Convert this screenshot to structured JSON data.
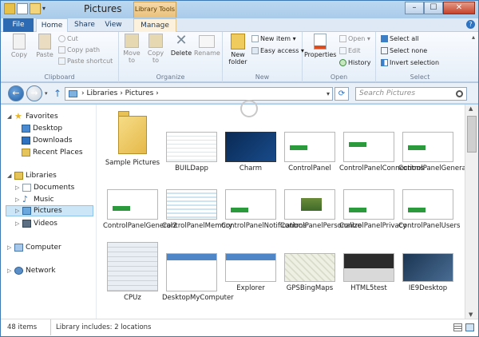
{
  "window": {
    "title": "Pictures",
    "context_tab": "Library Tools",
    "buttons": {
      "minimize": "–",
      "maximize": "☐",
      "close": "✕"
    }
  },
  "tabs": [
    "File",
    "Home",
    "Share",
    "View",
    "Manage"
  ],
  "ribbon": {
    "clipboard": {
      "label": "Clipboard",
      "copy": "Copy",
      "paste": "Paste",
      "cut": "Cut",
      "copy_path": "Copy path",
      "paste_shortcut": "Paste shortcut"
    },
    "organize": {
      "label": "Organize",
      "move_to": "Move to",
      "copy_to": "Copy to",
      "delete": "Delete",
      "rename": "Rename"
    },
    "new": {
      "label": "New",
      "new_folder": "New folder",
      "new_item": "New item ▾",
      "easy_access": "Easy access ▾"
    },
    "open": {
      "label": "Open",
      "properties": "Properties",
      "open": "Open ▾",
      "edit": "Edit",
      "history": "History"
    },
    "select": {
      "label": "Select",
      "select_all": "Select all",
      "select_none": "Select none",
      "invert_selection": "Invert selection"
    }
  },
  "address": {
    "path": "› Libraries › Pictures ›",
    "search_placeholder": "Search Pictures"
  },
  "nav": {
    "favorites": "Favorites",
    "desktop": "Desktop",
    "downloads": "Downloads",
    "recent_places": "Recent Places",
    "libraries": "Libraries",
    "documents": "Documents",
    "music": "Music",
    "pictures": "Pictures",
    "videos": "Videos",
    "computer": "Computer",
    "network": "Network"
  },
  "items": [
    {
      "name": "Sample Pictures",
      "kind": "folder"
    },
    {
      "name": "BUILDapp",
      "kind": "screen"
    },
    {
      "name": "Charm",
      "kind": "dark"
    },
    {
      "name": "ControlPanel",
      "kind": "panel"
    },
    {
      "name": "ControlPanelConnections",
      "kind": "panel"
    },
    {
      "name": "ControlPanelGeneral",
      "kind": "panel"
    },
    {
      "name": "ControlPanelGeneral2",
      "kind": "panel"
    },
    {
      "name": "ControlPanelMemory",
      "kind": "panel"
    },
    {
      "name": "ControlPanelNotifications",
      "kind": "panel"
    },
    {
      "name": "ControlPanelPersonalize",
      "kind": "photo"
    },
    {
      "name": "ControlPanelPrivacy",
      "kind": "panel"
    },
    {
      "name": "ControlPanelUsers",
      "kind": "panel"
    },
    {
      "name": "CPUz",
      "kind": "cpuz"
    },
    {
      "name": "DesktopMyComputer",
      "kind": "desktop"
    },
    {
      "name": "Explorer",
      "kind": "desktop"
    },
    {
      "name": "GPSBingMaps",
      "kind": "map"
    },
    {
      "name": "HTML5test",
      "kind": "html5"
    },
    {
      "name": "IE9Desktop",
      "kind": "ie9"
    }
  ],
  "status": {
    "count": "48 items",
    "library": "Library includes: 2 locations"
  }
}
